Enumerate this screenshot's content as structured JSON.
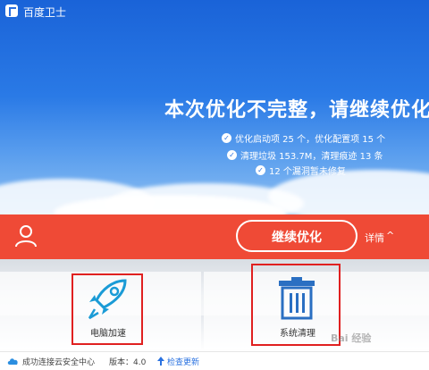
{
  "app": {
    "title": "百度卫士"
  },
  "hero": {
    "headline": "本次优化不完整，请继续优化",
    "stats": [
      "优化启动项 25 个，优化配置项 15 个",
      "清理垃圾 153.7M，清理痕迹 13 条",
      "12 个漏洞暂未修复"
    ]
  },
  "actions": {
    "continue_label": "继续优化",
    "details_label": "详情",
    "details_caret": "^"
  },
  "features": [
    {
      "label": "电脑加速",
      "icon": "rocket-icon"
    },
    {
      "label": "系统清理",
      "icon": "trash-icon"
    }
  ],
  "footer": {
    "cloud_status": "成功连接云安全中心",
    "version": "版本：4.0",
    "check_update": "检查更新"
  },
  "watermark": "Bai 经验",
  "colors": {
    "hero_blue": "#2a72e0",
    "action_red": "#ef4a36",
    "highlight_red": "#e02020"
  }
}
